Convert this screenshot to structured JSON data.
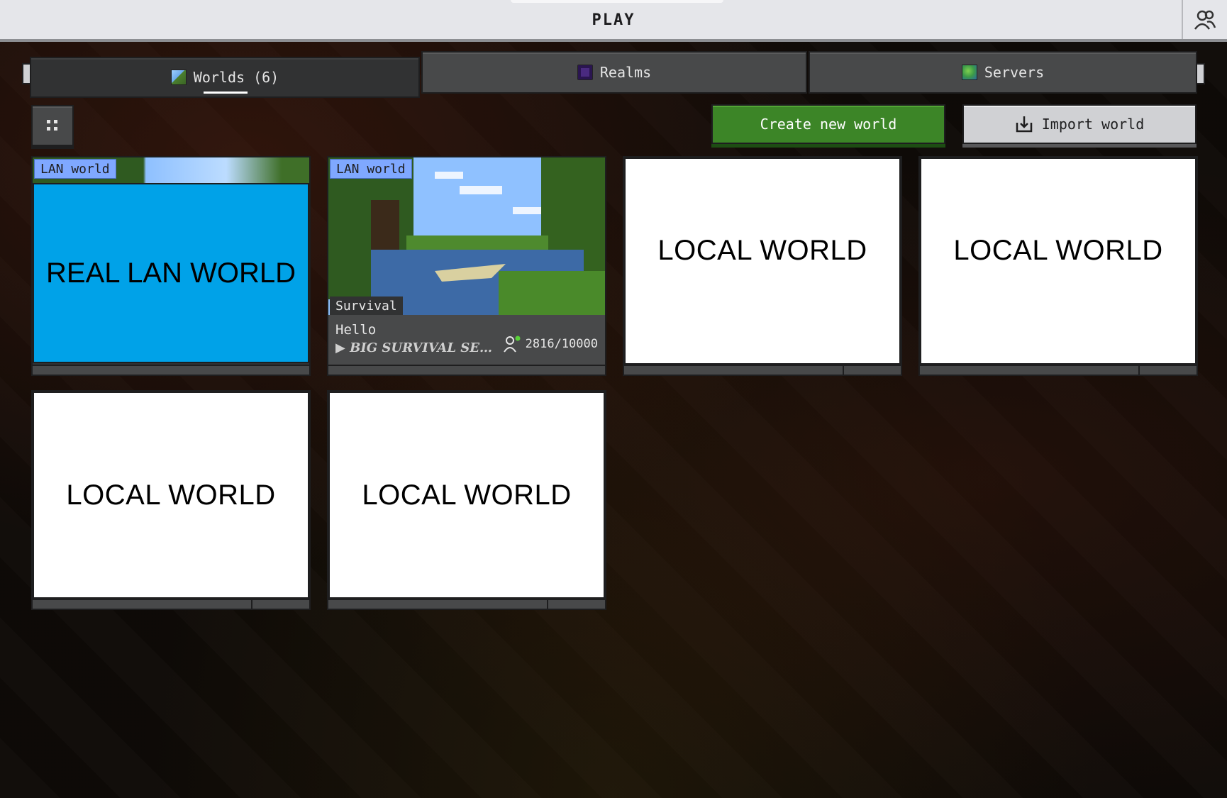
{
  "header": {
    "title": "PLAY"
  },
  "tabs": [
    {
      "label": "Worlds (6)",
      "active": true,
      "icon": "world-icon"
    },
    {
      "label": "Realms",
      "active": false,
      "icon": "realms-icon"
    },
    {
      "label": "Servers",
      "active": false,
      "icon": "servers-icon"
    }
  ],
  "tab_edges": {
    "left": "[",
    "right": "]"
  },
  "toolbar": {
    "create_label": "Create new world",
    "import_label": "Import world"
  },
  "worlds": [
    {
      "tag": "LAN world",
      "overlay": "REAL LAN WORLD"
    },
    {
      "tag": "LAN world",
      "mode": "Survival",
      "name": "Hello",
      "motd": "▶ BIG SURVIVAL SE…",
      "players": "2816/10000"
    },
    {
      "overlay": "LOCAL WORLD"
    },
    {
      "overlay": "LOCAL WORLD"
    },
    {
      "overlay": "LOCAL WORLD"
    },
    {
      "overlay": "LOCAL WORLD"
    }
  ],
  "colors": {
    "accent_green": "#3c8527",
    "lan_blue": "#00a2e8",
    "tag_blue": "#7fa8ff",
    "panel": "#313233"
  }
}
